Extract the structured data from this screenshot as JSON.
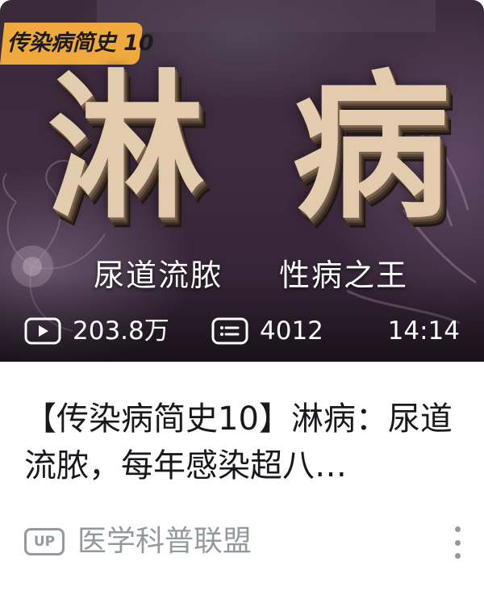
{
  "thumbnail": {
    "series_badge": "传染病简史 10",
    "big_title_chars": [
      "淋",
      "病"
    ],
    "tagline_left": "尿道流脓",
    "tagline_right": "性病之王",
    "views": "203.8万",
    "danmaku": "4012",
    "duration": "14:14",
    "colors": {
      "badge": "#f0a93c",
      "title_face": "#e3cbae",
      "background": "#3f2b3e"
    },
    "icons": {
      "views": "play-icon",
      "danmaku": "danmaku-icon"
    }
  },
  "video": {
    "title": "【传染病简史10】淋病：尿道流脓，每年感染超八…",
    "up_badge": "UP",
    "author": "医学科普联盟",
    "more_icon": "more-vertical-icon"
  }
}
